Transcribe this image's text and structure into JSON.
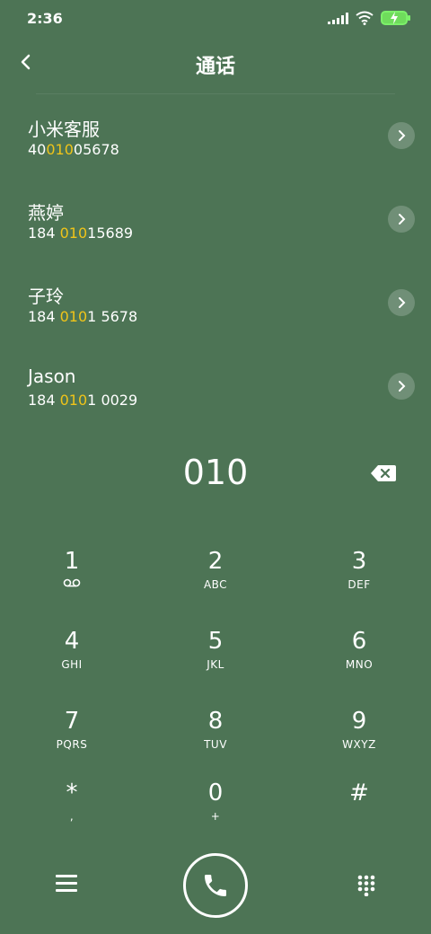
{
  "status": {
    "time": "2:36"
  },
  "header": {
    "title": "通话"
  },
  "contacts": [
    {
      "name": "小米客服",
      "num_pre": "40",
      "num_hl": "010",
      "num_post": "05678"
    },
    {
      "name": "燕婷",
      "num_pre": "184 ",
      "num_hl": "010",
      "num_post": "15689"
    },
    {
      "name": "子玲",
      "num_pre": "184 ",
      "num_hl": "010",
      "num_post": "1 5678"
    },
    {
      "name": "Jason",
      "num_pre": "184 ",
      "num_hl": "010",
      "num_post": "1 0029"
    }
  ],
  "dialer": {
    "input": "010"
  },
  "keys": [
    {
      "digit": "1",
      "letters": ""
    },
    {
      "digit": "2",
      "letters": "ABC"
    },
    {
      "digit": "3",
      "letters": "DEF"
    },
    {
      "digit": "4",
      "letters": "GHI"
    },
    {
      "digit": "5",
      "letters": "JKL"
    },
    {
      "digit": "6",
      "letters": "MNO"
    },
    {
      "digit": "7",
      "letters": "PQRS"
    },
    {
      "digit": "8",
      "letters": "TUV"
    },
    {
      "digit": "9",
      "letters": "WXYZ"
    },
    {
      "digit": "*",
      "letters": ","
    },
    {
      "digit": "0",
      "letters": "+"
    },
    {
      "digit": "#",
      "letters": ""
    }
  ],
  "icons": {
    "back": "back-arrow-icon",
    "chevron": "chevron-right-icon",
    "backspace": "backspace-icon",
    "voicemail": "voicemail-icon",
    "menu": "menu-icon",
    "call": "phone-icon",
    "keypad": "keypad-grid-icon"
  },
  "colors": {
    "background": "#4d7455",
    "highlight": "#f0c419",
    "battery": "#6fdc5c"
  }
}
